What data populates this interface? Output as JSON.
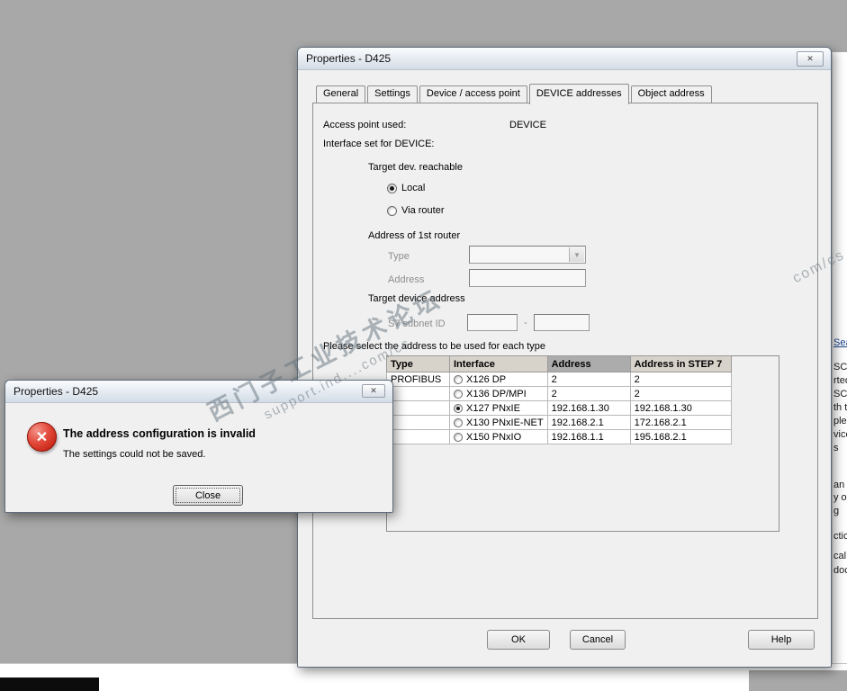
{
  "main_dialog": {
    "title": "Properties - D425",
    "tabs": [
      {
        "label": "General"
      },
      {
        "label": "Settings"
      },
      {
        "label": "Device / access point"
      },
      {
        "label": "DEVICE addresses"
      },
      {
        "label": "Object address"
      }
    ],
    "fields": {
      "access_point_label": "Access point used:",
      "access_point_value": "DEVICE",
      "interface_set_label": "Interface set for DEVICE:",
      "target_reachable_label": "Target dev. reachable",
      "radio_local": "Local",
      "radio_via_router": "Via router",
      "router_section_label": "Address of 1st router",
      "type_label": "Type",
      "address_label": "Address",
      "target_device_label": "Target device address",
      "subnet_label": "S7 subnet ID",
      "subnet_sep": "-",
      "table_caption": "Please select the address to be used for each type"
    },
    "table": {
      "headers": [
        "Type",
        "Interface",
        "Address",
        "Address in STEP 7"
      ],
      "rows": [
        {
          "type": "PROFIBUS",
          "interface": "X126 DP",
          "selected": false,
          "address": "2",
          "step7": "2"
        },
        {
          "type": "",
          "interface": "X136 DP/MPI",
          "selected": false,
          "address": "2",
          "step7": "2"
        },
        {
          "type": "",
          "interface": "X127 PNxIE",
          "selected": true,
          "address": "192.168.1.30",
          "step7": "192.168.1.30"
        },
        {
          "type": "",
          "interface": "X130 PNxIE-NET",
          "selected": false,
          "address": "192.168.2.1",
          "step7": "172.168.2.1"
        },
        {
          "type": "",
          "interface": "X150 PNxIO",
          "selected": false,
          "address": "192.168.1.1",
          "step7": "195.168.2.1"
        }
      ]
    },
    "buttons": {
      "ok": "OK",
      "cancel": "Cancel",
      "help": "Help"
    }
  },
  "error_dialog": {
    "title": "Properties - D425",
    "message_title": "The address configuration is invalid",
    "message_body": "The settings could not be saved.",
    "close_button": "Close"
  },
  "watermark": {
    "line1": "西门子工业技术论坛",
    "line2": "support.ind....com/cs",
    "fragment": "com/cs"
  },
  "right_edge": {
    "fragments": [
      "Sea",
      "SC",
      "rted",
      "SC",
      "th th",
      "ples",
      "vice",
      "s",
      "an",
      "y or",
      "g",
      "ction",
      "cal",
      "doc"
    ]
  },
  "icons": {
    "close": "✕",
    "dropdown": "▼",
    "error_x": "✕"
  }
}
